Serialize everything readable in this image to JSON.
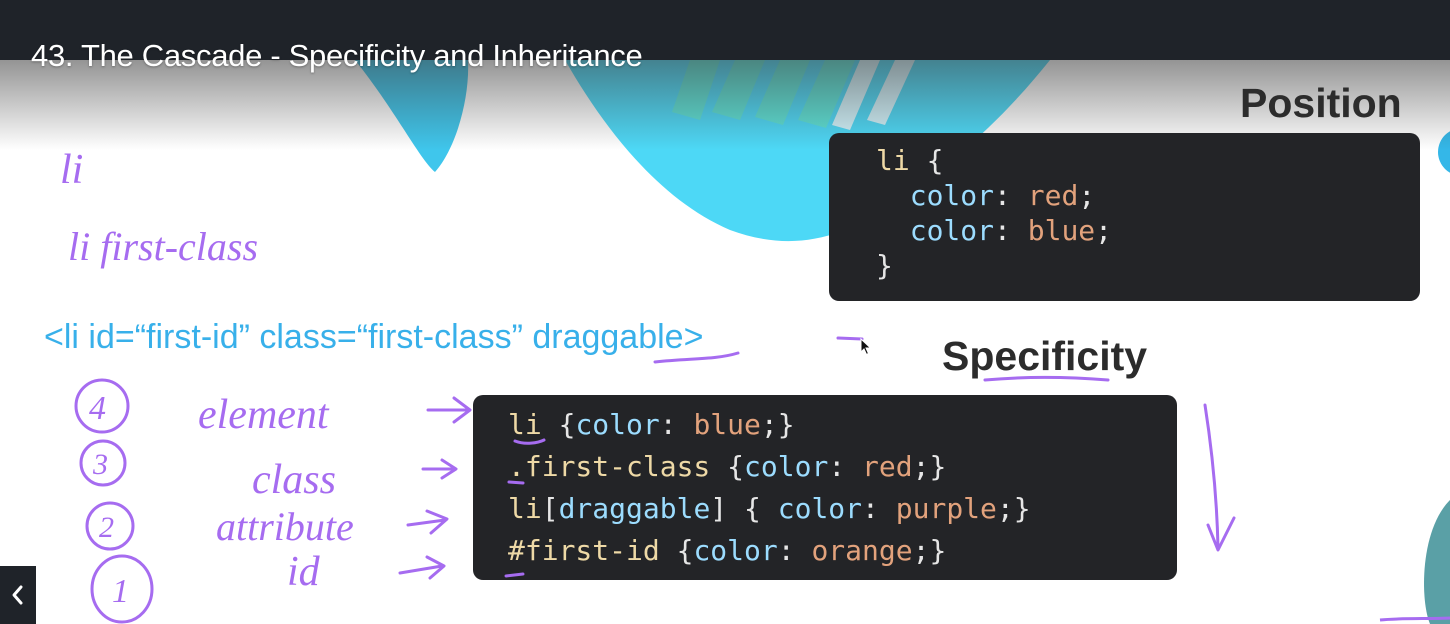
{
  "video": {
    "title": "43. The Cascade - Specificity and Inheritance"
  },
  "position_section": {
    "label": "Position",
    "code": [
      {
        "sel": "li",
        "brace": " {"
      },
      {
        "prop": "color",
        "val": "red"
      },
      {
        "prop": "color",
        "val": "blue"
      },
      {
        "close": "}"
      }
    ]
  },
  "specificity_section": {
    "label": "Specificity",
    "code": [
      {
        "sel": "li",
        "rule_open": " {",
        "prop": "color",
        "val": "blue",
        "rule_close": ";}"
      },
      {
        "sel": ".first-class",
        "rule_open": " {",
        "prop": "color",
        "val": "red",
        "rule_close": ";}"
      },
      {
        "sel_base": "li",
        "sel_open": "[",
        "attr": "draggable",
        "sel_close": "]",
        "rule_open": " { ",
        "prop": "color",
        "val": "purple",
        "rule_close": ";}"
      },
      {
        "sel": "#first-id",
        "rule_open": " {",
        "prop": "color",
        "val": "orange",
        "rule_close": ";}"
      }
    ]
  },
  "html_example": "<li id=“first-id” class=“first-class” draggable>",
  "annotations": {
    "li": "li",
    "li_first_class": "li first-class",
    "rank_4": "4",
    "rank_3": "3",
    "rank_2": "2",
    "rank_1": "1",
    "element": "element",
    "class": "class",
    "attribute": "attribute",
    "id": "id"
  },
  "icons": {
    "back": "chevron-left-icon",
    "cursor": "mouse-pointer-icon"
  },
  "colors": {
    "ink": "#a66cf0",
    "html_text": "#38b0ea",
    "code_bg": "#232427",
    "topbar": "#1f2329"
  }
}
